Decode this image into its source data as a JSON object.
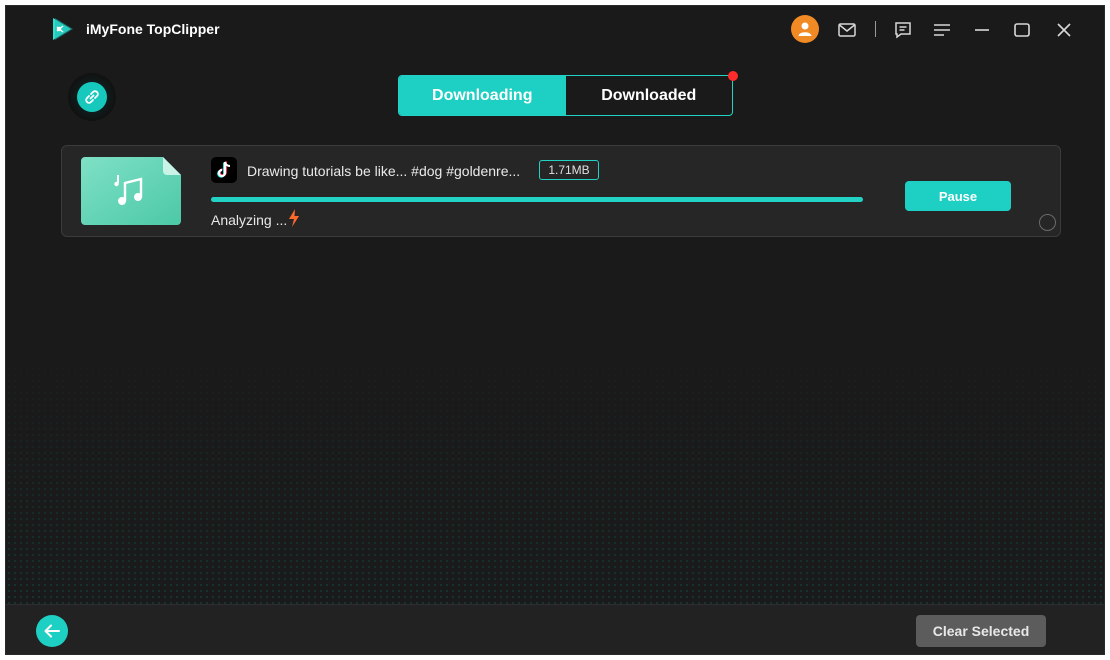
{
  "app": {
    "title": "iMyFone TopClipper"
  },
  "titlebar": {
    "icons": [
      "avatar-icon",
      "mail-icon",
      "feedback-icon",
      "menu-icon",
      "minimize-icon",
      "maximize-icon",
      "close-icon"
    ]
  },
  "tabs": [
    {
      "label": "Downloading",
      "active": true
    },
    {
      "label": "Downloaded",
      "active": false,
      "has_notification": true
    }
  ],
  "downloads": [
    {
      "source_icon": "tiktok-icon",
      "title": "Drawing tutorials be like... #dog #goldenre...",
      "size": "1.71MB",
      "progress": 1.0,
      "status": "Analyzing ...",
      "action_label": "Pause"
    }
  ],
  "footer": {
    "clear_label": "Clear Selected"
  },
  "colors": {
    "accent": "#1ecfc3",
    "background": "#1a1a1a",
    "avatar": "#f08a24",
    "notification": "#ff2a2a",
    "bolt": "#ff6a2a"
  }
}
